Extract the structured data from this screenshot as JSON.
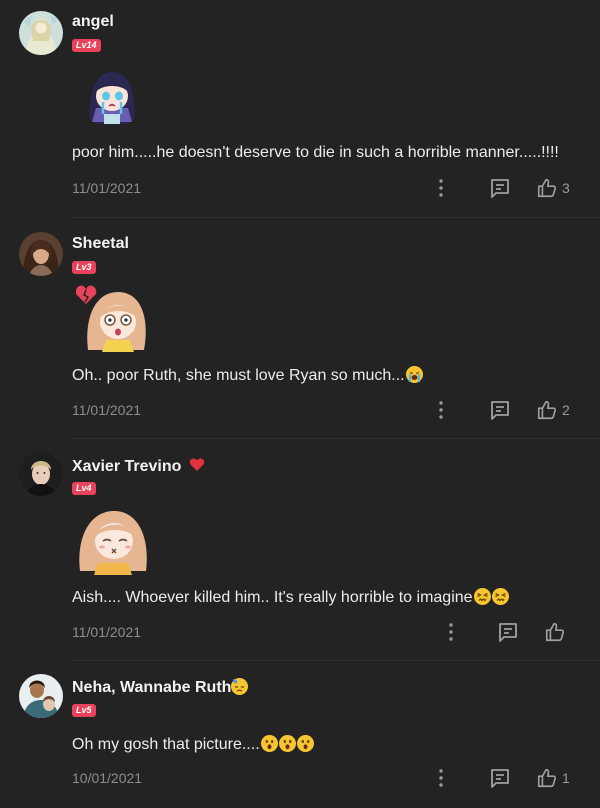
{
  "comments": [
    {
      "username": "angel",
      "level": "Lv14",
      "text": "poor him.....he doesn't deserve to die in such a horrible manner.....!!!!",
      "date": "11/01/2021",
      "likes": "3"
    },
    {
      "username": "Sheetal",
      "level": "Lv3",
      "text": "Oh.. poor Ruth, she must love Ryan so much...",
      "date": "11/01/2021",
      "likes": "2"
    },
    {
      "username": "Xavier Trevino",
      "level": "Lv4",
      "text": "Aish.... Whoever killed him.. It's really horrible to imagine",
      "date": "11/01/2021",
      "likes": ""
    },
    {
      "username": "Neha, Wannabe Ruth",
      "level": "Lv5",
      "text": "Oh my gosh that picture....",
      "date": "10/01/2021",
      "likes": "1"
    }
  ],
  "colors": {
    "background": "#232323",
    "level_badge": "#e8435a",
    "secondary_text": "#8d8d8d"
  },
  "icons": [
    "more-vertical-icon",
    "reply-comment-icon",
    "thumbs-up-icon",
    "heart-icon"
  ]
}
